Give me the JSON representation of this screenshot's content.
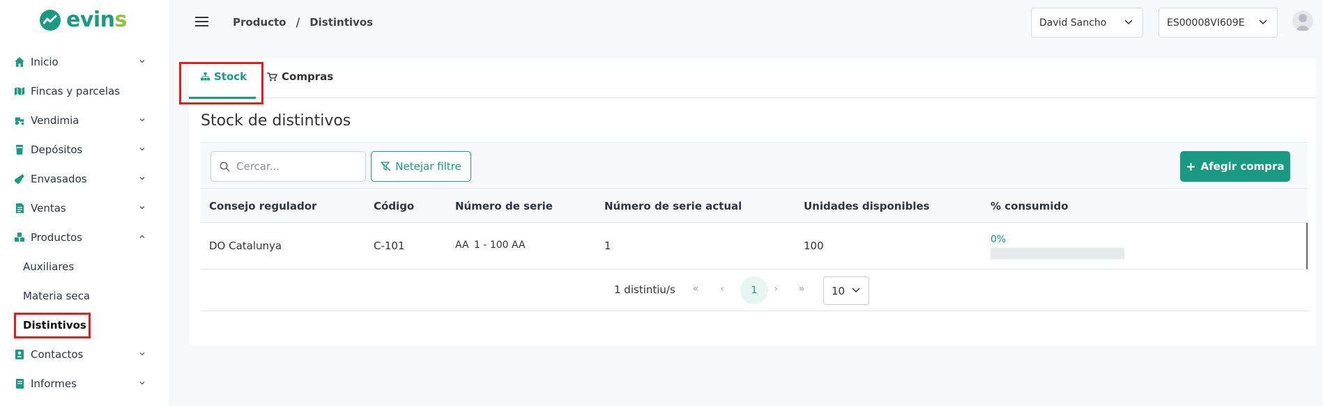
{
  "brand": {
    "name_primary": "evin",
    "name_accent": "s",
    "color": "#1a9a83",
    "accent_color": "#8cc63f"
  },
  "sidebar": {
    "items": [
      {
        "label": "Inicio",
        "icon": "home-icon",
        "has_chevron": true
      },
      {
        "label": "Fincas y parcelas",
        "icon": "map-icon",
        "has_chevron": false
      },
      {
        "label": "Vendimia",
        "icon": "tractor-icon",
        "has_chevron": true
      },
      {
        "label": "Depósitos",
        "icon": "tank-icon",
        "has_chevron": true
      },
      {
        "label": "Envasados",
        "icon": "bottle-icon",
        "has_chevron": true
      },
      {
        "label": "Ventas",
        "icon": "invoice-icon",
        "has_chevron": true
      },
      {
        "label": "Productos",
        "icon": "boxes-icon",
        "has_chevron": true,
        "expanded": true
      },
      {
        "label": "Contactos",
        "icon": "contact-icon",
        "has_chevron": true
      },
      {
        "label": "Informes",
        "icon": "book-icon",
        "has_chevron": true
      }
    ],
    "sub_items": [
      {
        "label": "Auxiliares"
      },
      {
        "label": "Materia seca"
      },
      {
        "label": "Distintivos",
        "active": true
      }
    ]
  },
  "header": {
    "breadcrumb": [
      "Producto",
      "Distintivos"
    ],
    "breadcrumb_sep": "/",
    "user_select": "David Sancho",
    "cellar_select": "ES00008VI609E"
  },
  "tabs": [
    {
      "label": "Stock",
      "icon": "sitemap-icon",
      "active": true
    },
    {
      "label": "Compras",
      "icon": "cart-icon",
      "active": false
    }
  ],
  "main": {
    "title": "Stock de distintivos",
    "search_placeholder": "Cercar...",
    "filter_button": "Netejar filtre",
    "add_button": "Afegir compra"
  },
  "table": {
    "columns": [
      "Consejo regulador",
      "Código",
      "Número de serie",
      "Número de serie actual",
      "Unidades disponibles",
      "% consumido"
    ],
    "rows": [
      {
        "consejo": "DO Catalunya",
        "codigo": "C-101",
        "serie_prefix": "AA",
        "serie_range": "1 - 100",
        "serie_suffix": "AA",
        "serie_actual": "1",
        "unidades": "100",
        "consumido_label": "0%",
        "consumido_fraction": 0
      }
    ]
  },
  "pagination": {
    "count_label": "1 distintiu/s",
    "current_page": "1",
    "page_size": "10",
    "first": "«",
    "prev": "‹",
    "next": "›",
    "last": "»"
  }
}
